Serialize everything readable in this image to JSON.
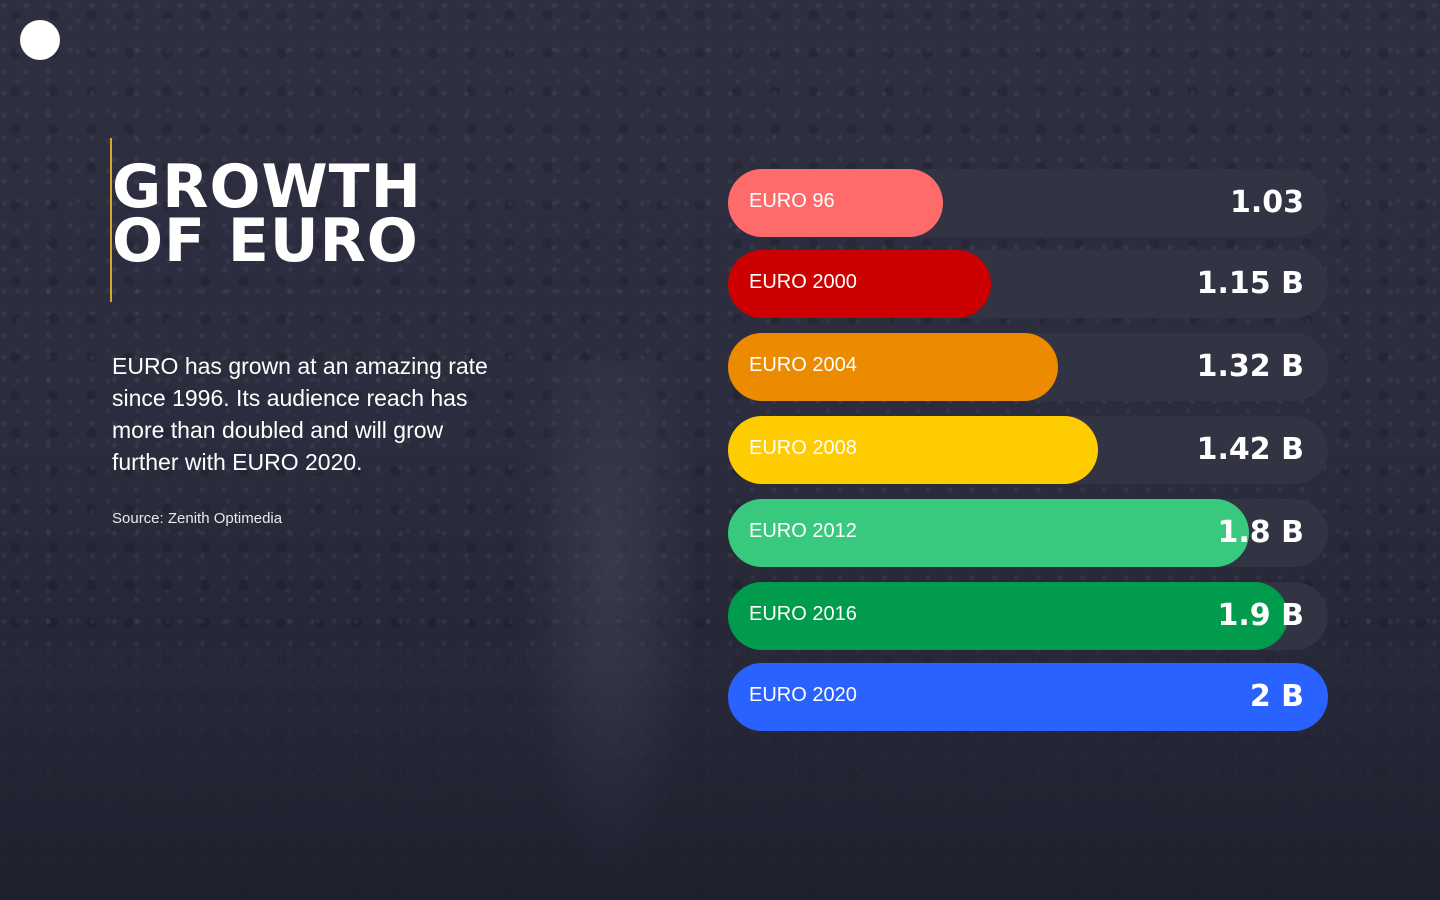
{
  "header": {
    "title": "GROWTH\nOF EURO",
    "description": "EURO has grown at an amazing rate since 1996. Its audience reach has more than doubled and will grow further with EURO 2020.",
    "source": "Source: Zenith Optimedia"
  },
  "colors": {
    "background": "#2b2d3e",
    "track": "#323443",
    "accent_line": "#d8a72a"
  },
  "chart_data": {
    "type": "bar",
    "orientation": "horizontal",
    "title": "GROWTH OF EURO",
    "xlabel": "",
    "ylabel": "",
    "unit": "B",
    "xlim": [
      0,
      2
    ],
    "grid": false,
    "legend": "none",
    "categories": [
      "EURO 96",
      "EURO 2000",
      "EURO 2004",
      "EURO 2008",
      "EURO 2012",
      "EURO 2016",
      "EURO 2020"
    ],
    "values": [
      1.03,
      1.15,
      1.32,
      1.42,
      1.8,
      1.9,
      2.0
    ],
    "value_labels": [
      "1.03",
      "1.15 B",
      "1.32 B",
      "1.42 B",
      "1.8 B",
      "1.9 B",
      "2 B"
    ],
    "bar_colors": [
      "#ff6b6b",
      "#cc0000",
      "#ec8a00",
      "#ffcc00",
      "#38c97f",
      "#009b4d",
      "#2962ff"
    ]
  }
}
